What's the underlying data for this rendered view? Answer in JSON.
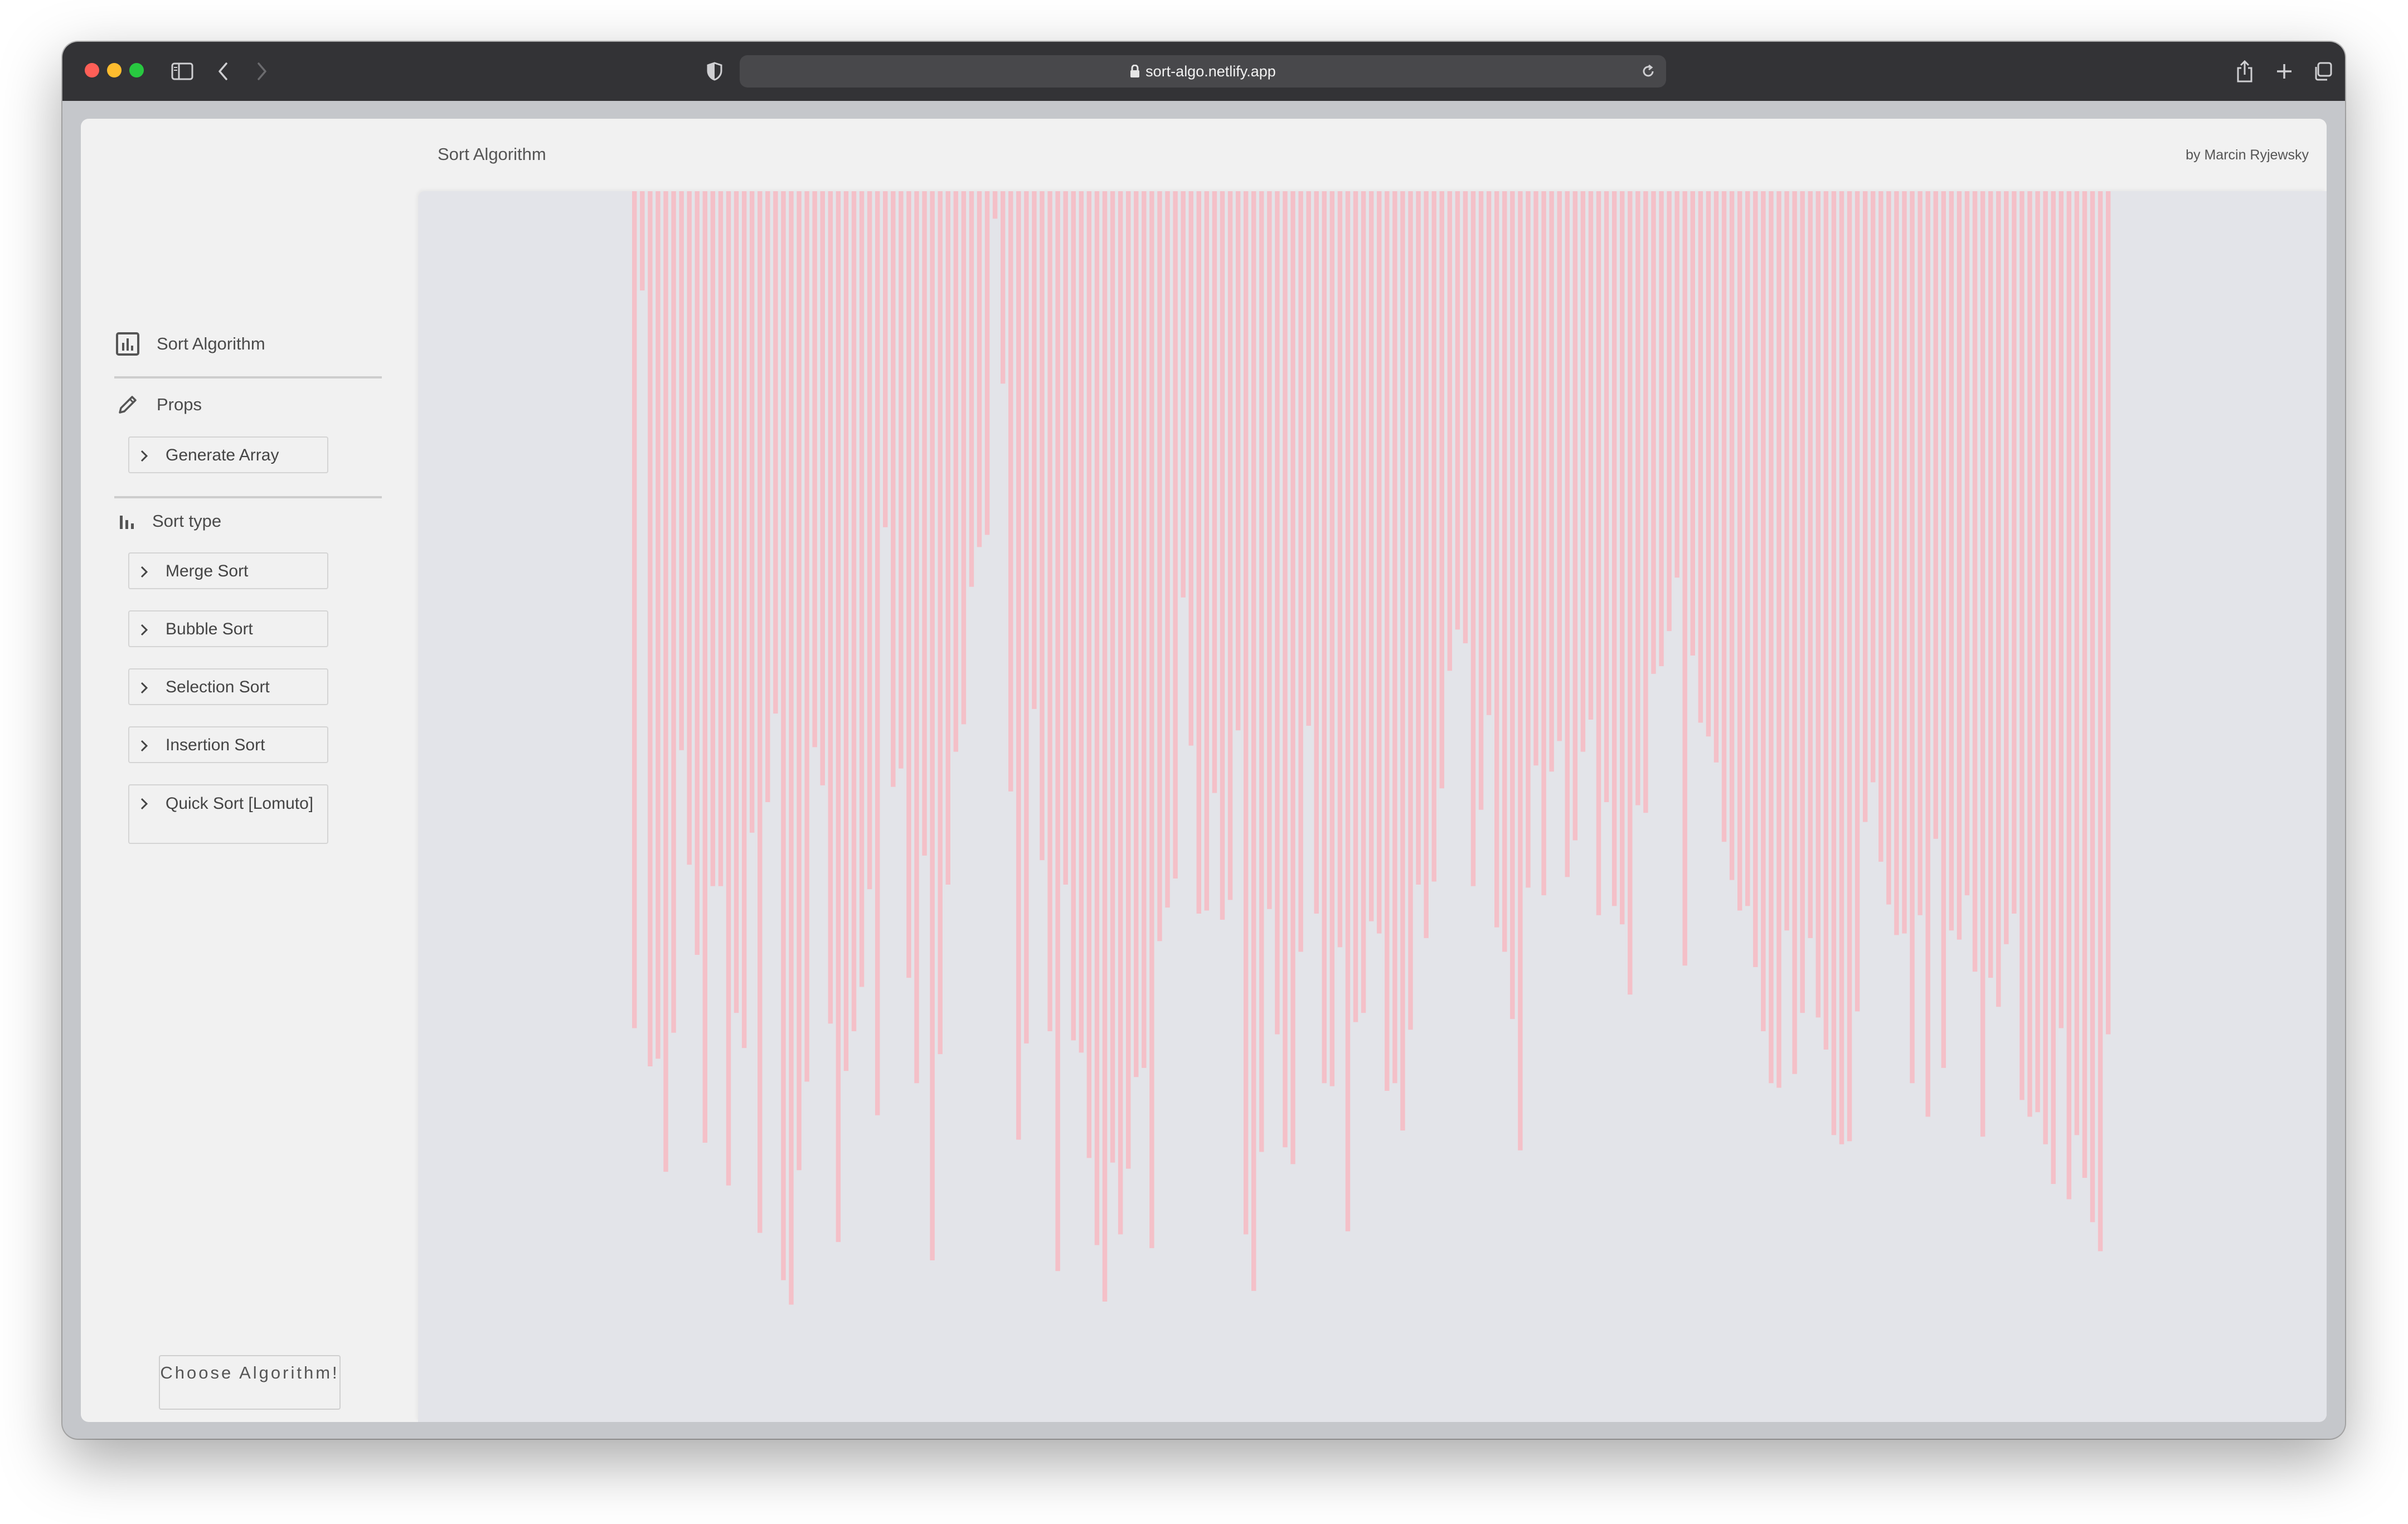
{
  "browser": {
    "url": "sort-algo.netlify.app"
  },
  "header": {
    "title": "Sort Algorithm",
    "author": "by Marcin Ryjewsky"
  },
  "sidebar": {
    "brand_label": "Sort Algorithm",
    "props_label": "Props",
    "generate_label": "Generate Array",
    "sort_type_label": "Sort type",
    "algorithms": [
      "Merge Sort",
      "Bubble Sort",
      "Selection Sort",
      "Insertion Sort",
      "Quick Sort [Lomuto]"
    ],
    "choose_label": "Choose Algorithm!"
  },
  "colors": {
    "bar": "#f4c0c8",
    "canvas": "#e3e4e9",
    "chrome": "#333336"
  },
  "chart_data": {
    "type": "bar",
    "orientation": "downward",
    "bar_count": 189,
    "values": [
      548,
      65,
      573,
      568,
      642,
      551,
      366,
      441,
      500,
      623,
      455,
      455,
      651,
      538,
      561,
      420,
      682,
      400,
      342,
      713,
      729,
      641,
      583,
      364,
      389,
      545,
      688,
      576,
      550,
      521,
      457,
      605,
      220,
      390,
      378,
      515,
      584,
      435,
      700,
      565,
      454,
      367,
      349,
      259,
      233,
      225,
      18,
      126,
      393,
      621,
      558,
      339,
      438,
      550,
      707,
      454,
      556,
      564,
      633,
      690,
      727,
      636,
      683,
      640,
      580,
      574,
      692,
      491,
      469,
      450,
      266,
      363,
      473,
      471,
      394,
      477,
      464,
      353,
      683,
      720,
      629,
      470,
      552,
      626,
      637,
      498,
      350,
      473,
      584,
      586,
      495,
      681,
      544,
      538,
      478,
      486,
      589,
      584,
      615,
      549,
      454,
      489,
      452,
      391,
      314,
      287,
      296,
      455,
      405,
      343,
      482,
      498,
      542,
      628,
      456,
      376,
      461,
      380,
      360,
      449,
      425,
      367,
      346,
      474,
      400,
      468,
      480,
      526,
      402,
      407,
      316,
      311,
      288,
      253,
      507,
      304,
      348,
      357,
      374,
      426,
      451,
      471,
      468,
      508,
      550,
      584,
      587,
      484,
      578,
      538,
      489,
      541,
      562,
      618,
      624,
      622,
      537,
      413,
      387,
      439,
      467,
      487,
      486,
      584,
      474,
      606,
      424,
      574,
      484,
      490,
      461,
      511,
      619,
      515,
      534,
      493,
      473,
      595,
      606,
      603,
      624,
      650,
      548,
      660,
      618,
      646,
      675,
      694,
      552
    ]
  }
}
